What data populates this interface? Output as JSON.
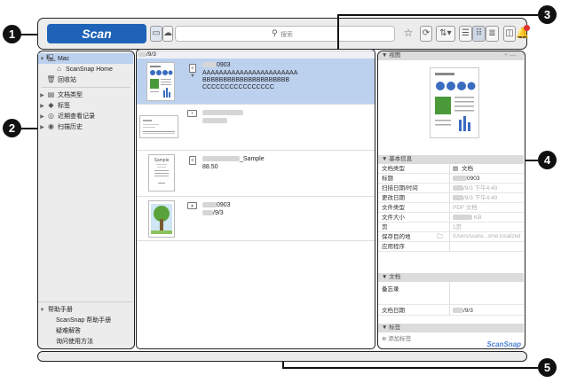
{
  "callouts": [
    "1",
    "2",
    "3",
    "4",
    "5"
  ],
  "toolbar": {
    "scan_label": "Scan",
    "search_placeholder": "搜索"
  },
  "sidebar": {
    "items": [
      {
        "label": "Mac",
        "icon": "computer-icon"
      },
      {
        "label": "ScanSnap Home",
        "icon": "home-icon"
      },
      {
        "label": "回收站",
        "icon": "trash-icon"
      },
      {
        "label": "文档类型",
        "icon": "document-type-icon"
      },
      {
        "label": "标签",
        "icon": "tag-icon"
      },
      {
        "label": "近期查看记录",
        "icon": "recent-icon"
      },
      {
        "label": "扫描历史",
        "icon": "history-icon"
      }
    ],
    "help": {
      "header": "帮助手册",
      "items": [
        "ScanSnap 帮助手册",
        "疑难解答",
        "询问使用方法"
      ]
    }
  },
  "center": {
    "path": "/9/3",
    "items": [
      {
        "title": "0903",
        "lines": [
          "AAAAAAAAAAAAAAAAAAAAAAA",
          "BBBBBBBBBBBBBBBBBBBBB",
          "CCCCCCCCCCCCCCCC"
        ]
      },
      {
        "title": "",
        "lines": []
      },
      {
        "title": "_Sample",
        "lines": [
          "88.50"
        ],
        "thumb_label": "Sample"
      },
      {
        "title": "0903",
        "lines": [
          "/9/3"
        ]
      }
    ]
  },
  "right": {
    "view_header": "视图",
    "basic_header": "基本信息",
    "props": [
      {
        "k": "文档类型",
        "v": "文档"
      },
      {
        "k": "标题",
        "v": "0903"
      },
      {
        "k": "扫描日期/时间",
        "v": "/9/3 下午4:40"
      },
      {
        "k": "更改日期",
        "v": "/9/3 下午4:40"
      },
      {
        "k": "文件类型",
        "v": "PDF 文档"
      },
      {
        "k": "文件大小",
        "v": "KB"
      },
      {
        "k": "页",
        "v": "1页"
      },
      {
        "k": "保存目的地",
        "v": "/Users/scans...ome.localized"
      },
      {
        "k": "应用程序",
        "v": ""
      }
    ],
    "doc_header": "文档",
    "memo_label": "备忘录",
    "doc_date_label": "文档日期",
    "doc_date_value": "/9/3",
    "tag_header": "标签",
    "add_tag": "添加标签",
    "brand": "ScanSnap"
  },
  "colors": {
    "accent": "#1f63b8",
    "selection": "#bcd1ee",
    "notification": "#e03030"
  }
}
